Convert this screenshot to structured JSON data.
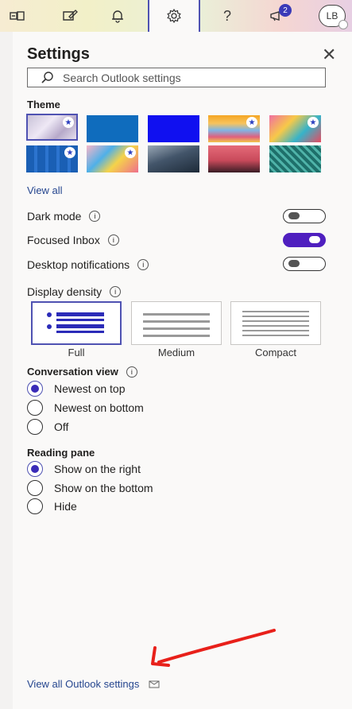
{
  "toolbar": {
    "icons": [
      "teams-icon",
      "compose-feedback-icon",
      "bell-icon",
      "gear-icon",
      "help-icon",
      "megaphone-icon"
    ],
    "help_label": "?",
    "notification_count": "2",
    "avatar_initials": "LB"
  },
  "settings": {
    "title": "Settings",
    "search_placeholder": "Search Outlook settings",
    "theme": {
      "heading": "Theme",
      "view_all": "View all"
    },
    "toggles": [
      {
        "label": "Dark mode",
        "on": false
      },
      {
        "label": "Focused Inbox",
        "on": true
      },
      {
        "label": "Desktop notifications",
        "on": false
      }
    ],
    "display_density": {
      "heading": "Display density",
      "options": [
        "Full",
        "Medium",
        "Compact"
      ],
      "selected": "Full"
    },
    "conversation_view": {
      "heading": "Conversation view",
      "options": [
        "Newest on top",
        "Newest on bottom",
        "Off"
      ],
      "selected": "Newest on top"
    },
    "reading_pane": {
      "heading": "Reading pane",
      "options": [
        "Show on the right",
        "Show on the bottom",
        "Hide"
      ],
      "selected": "Show on the right"
    },
    "view_all_settings": "View all Outlook settings"
  },
  "colors": {
    "accent": "#4f52b2",
    "toggle_on": "#4f1fbf",
    "link": "#25468f",
    "annotation_arrow": "#e8201a"
  }
}
